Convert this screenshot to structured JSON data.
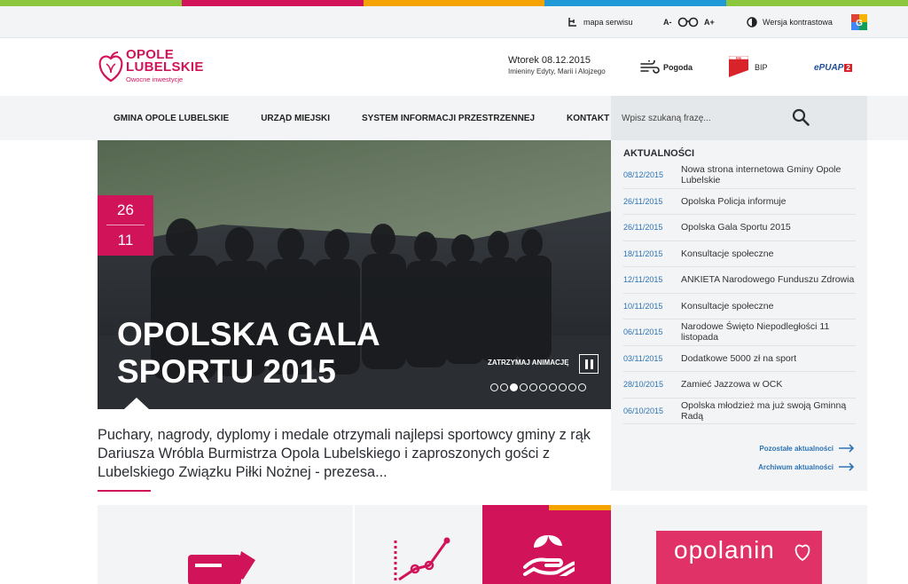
{
  "colors": {
    "brand": "#d1145a",
    "link": "#2e74b5",
    "topbar": [
      "#8cc63e",
      "#d1145a",
      "#f5a300",
      "#1f9ad6",
      "#8cc63e"
    ]
  },
  "topbar": {
    "sitemap_label": "mapa serwisu",
    "font_smaller": "A-",
    "font_larger": "A+",
    "contrast_label": "Wersja kontrastowa",
    "icons": [
      "sitemap-icon",
      "glasses-icon",
      "contrast-icon",
      "translate-icon"
    ]
  },
  "header": {
    "logo_line1": "OPOLE",
    "logo_line2": "LUBELSKIE",
    "logo_tagline": "Owocne inwestycje",
    "date": "Wtorek 08.12.2015",
    "nameday": "Imieniny Edyty, Marii i Alojzego",
    "weather_label": "Pogoda",
    "bip_label": "BIP",
    "epuap_label": "ePUAP",
    "epuap_badge": "2"
  },
  "nav": {
    "items": [
      "GMINA OPOLE LUBELSKIE",
      "URZĄD MIEJSKI",
      "SYSTEM INFORMACJI PRZESTRZENNEJ",
      "KONTAKT"
    ],
    "search_placeholder": "Wpisz szukaną frazę..."
  },
  "slider": {
    "day": "26",
    "month": "11",
    "title_line1": "OPOLSKA GALA",
    "title_line2": "SPORTU 2015",
    "pause_label": "ZATRZYMAJ ANIMACJĘ",
    "slide_count": 10,
    "active_slide": 3
  },
  "lead": "Puchary, nagrody, dyplomy i medale otrzymali najlepsi sportowcy gminy z rąk Dariusza Wróbla Burmistrza Opola Lubelskiego i zaproszonych gości z Lubelskiego Związku Piłki Nożnej - prezesa...",
  "news": {
    "heading": "AKTUALNOŚCI",
    "items": [
      {
        "date": "08/12/2015",
        "title": "Nowa strona internetowa Gminy Opole Lubelskie"
      },
      {
        "date": "26/11/2015",
        "title": "Opolska Policja informuje"
      },
      {
        "date": "26/11/2015",
        "title": "Opolska Gala Sportu 2015"
      },
      {
        "date": "18/11/2015",
        "title": "Konsultacje społeczne"
      },
      {
        "date": "12/11/2015",
        "title": "ANKIETA Narodowego Funduszu Zdrowia"
      },
      {
        "date": "10/11/2015",
        "title": "Konsultacje społeczne"
      },
      {
        "date": "06/11/2015",
        "title": "Narodowe Święto Niepodległości 11 listopada"
      },
      {
        "date": "03/11/2015",
        "title": "Dodatkowe 5000 zł na sport"
      },
      {
        "date": "28/10/2015",
        "title": "Zamieć Jazzowa w OCK"
      },
      {
        "date": "06/10/2015",
        "title": "Opolska młodzież ma już swoją Gminną Radą"
      }
    ],
    "more_label": "Pozostałe aktualności",
    "archive_label": "Archiwum aktualności"
  },
  "tiles": {
    "opolanin_title": "opolanin"
  }
}
